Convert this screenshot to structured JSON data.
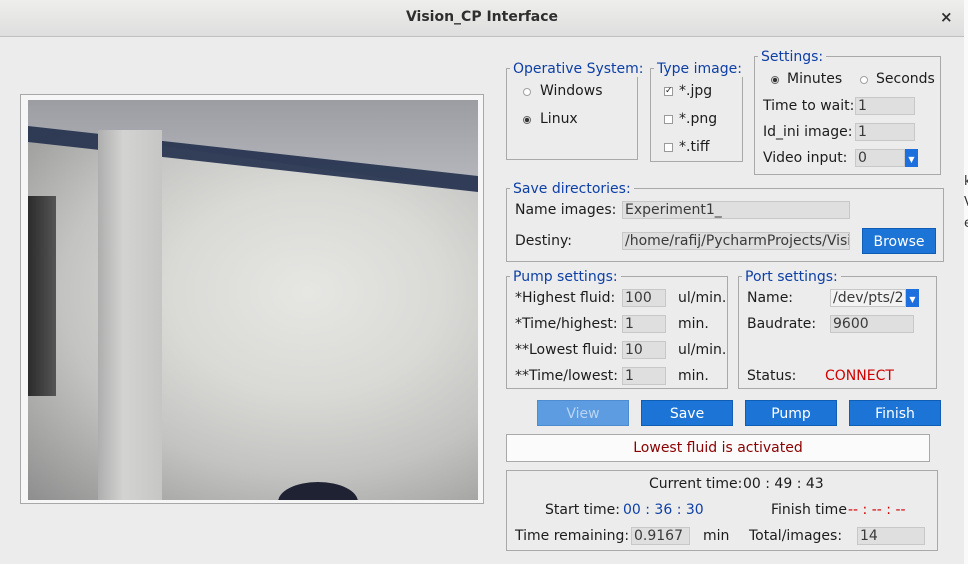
{
  "window": {
    "title": "Vision_CP Interface",
    "close_glyph": "×"
  },
  "operative_system": {
    "title": "Operative System:",
    "options": [
      {
        "label": "Windows",
        "selected": false
      },
      {
        "label": "Linux",
        "selected": true
      }
    ]
  },
  "type_image": {
    "title": "Type image:",
    "options": [
      {
        "label": "*.jpg",
        "checked": true
      },
      {
        "label": "*.png",
        "checked": false
      },
      {
        "label": "*.tiff",
        "checked": false
      }
    ]
  },
  "settings": {
    "title": "Settings:",
    "units": [
      {
        "label": "Minutes",
        "selected": true
      },
      {
        "label": "Seconds",
        "selected": false
      }
    ],
    "time_to_wait_label": "Time to wait:",
    "time_to_wait": "1",
    "id_ini_label": "Id_ini image:",
    "id_ini": "1",
    "video_input_label": "Video input:",
    "video_input": "0"
  },
  "save_directories": {
    "title": "Save directories:",
    "name_label": "Name images:",
    "name_value": "Experiment1_",
    "destiny_label": "Destiny:",
    "destiny_value": "/home/rafij/PycharmProjects/Vision_",
    "browse_label": "Browse"
  },
  "pump_settings": {
    "title": "Pump settings:",
    "rows": [
      {
        "label": "*Highest fluid:",
        "value": "100",
        "unit": "ul/min."
      },
      {
        "label": "*Time/highest:",
        "value": "1",
        "unit": "min."
      },
      {
        "label": "**Lowest fluid:",
        "value": "10",
        "unit": "ul/min."
      },
      {
        "label": "**Time/lowest:",
        "value": "1",
        "unit": "min."
      }
    ]
  },
  "port_settings": {
    "title": "Port settings:",
    "name_label": "Name:",
    "name_value": "/dev/pts/2",
    "baud_label": "Baudrate:",
    "baud_value": "9600",
    "status_label": "Status:",
    "status_value": "CONNECT"
  },
  "buttons": {
    "view": "View",
    "save": "Save",
    "pump": "Pump",
    "finish": "Finish"
  },
  "status_message": "Lowest fluid is activated",
  "timing": {
    "current_label": "Current time:",
    "current_value": "00 : 49 : 43",
    "start_label": "Start time:",
    "start_value": "00 : 36 : 30",
    "finish_label": "Finish time",
    "finish_value": "-- : -- : --",
    "remaining_label": "Time remaining:",
    "remaining_value": "0.9167",
    "remaining_unit": "min",
    "total_label": "Total/images:",
    "total_value": "14"
  },
  "edge_glyphs": [
    "k",
    "V",
    "e"
  ],
  "colors": {
    "accent": "#1c75d6",
    "group_title": "#0d3fa6",
    "status_red": "#d10000",
    "message": "#8b0000"
  }
}
